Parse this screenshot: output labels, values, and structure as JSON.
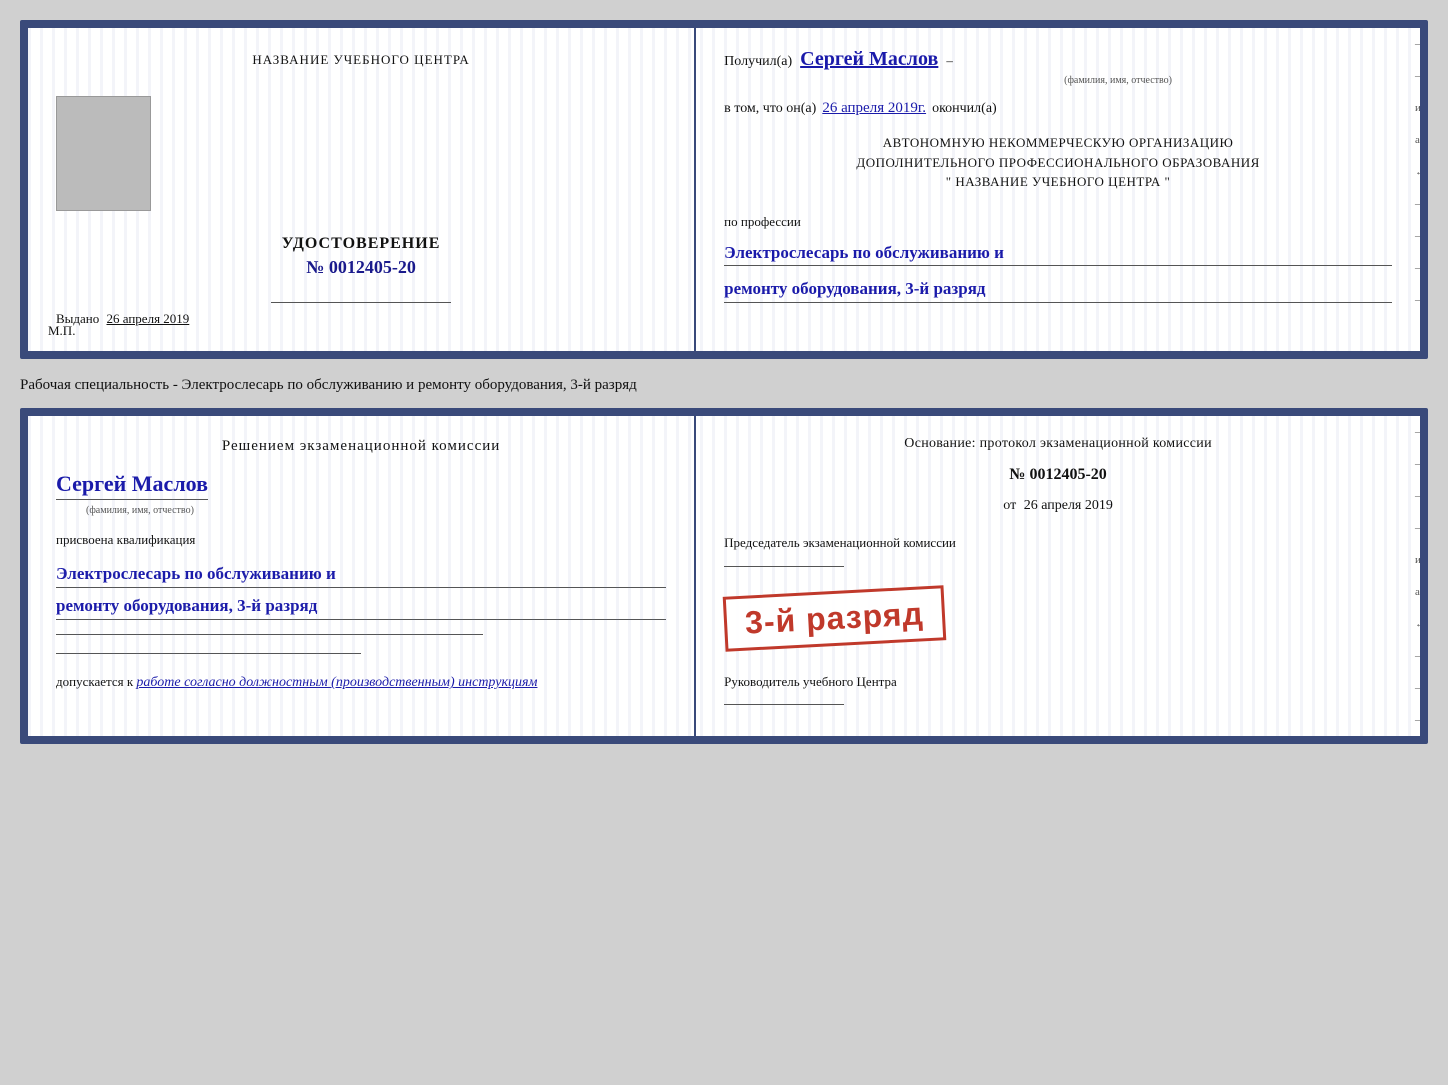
{
  "doc1": {
    "left": {
      "org_title": "НАЗВАНИЕ УЧЕБНОГО ЦЕНТРА",
      "cert_label": "УДОСТОВЕРЕНИЕ",
      "cert_number": "№ 0012405-20",
      "issue_label": "Выдано",
      "issue_date": "26 апреля 2019",
      "mp_label": "М.П."
    },
    "right": {
      "received_prefix": "Получил(а)",
      "recipient_name": "Сергей Маслов",
      "fio_sub": "(фамилия, имя, отчество)",
      "date_prefix": "в том, что он(а)",
      "date_value": "26 апреля 2019г.",
      "date_suffix": "окончил(а)",
      "org_line1": "АВТОНОМНУЮ НЕКОММЕРЧЕСКУЮ ОРГАНИЗАЦИЮ",
      "org_line2": "ДОПОЛНИТЕЛЬНОГО ПРОФЕССИОНАЛЬНОГО ОБРАЗОВАНИЯ",
      "org_line3": "\" НАЗВАНИЕ УЧЕБНОГО ЦЕНТРА \"",
      "profession_label": "по профессии",
      "profession_line1": "Электрослесарь по обслуживанию и",
      "profession_line2": "ремонту оборудования, 3-й разряд"
    }
  },
  "between_label": "Рабочая специальность - Электрослесарь по обслуживанию и ремонту оборудования, 3-й разряд",
  "doc2": {
    "left": {
      "komissia_title": "Решением экзаменационной комиссии",
      "name": "Сергей Маслов",
      "fio_sub": "(фамилия, имя, отчество)",
      "prisvoena": "присвоена квалификация",
      "qualification_line1": "Электрослесарь по обслуживанию и",
      "qualification_line2": "ремонту оборудования, 3-й разряд",
      "dopuskaetsya_prefix": "допускается к",
      "dopuskaetsya_text": "работе согласно должностным (производственным) инструкциям"
    },
    "right": {
      "osnova_text": "Основание: протокол экзаменационной комиссии",
      "proto_number": "№ 0012405-20",
      "proto_date_prefix": "от",
      "proto_date": "26 апреля 2019",
      "predsedatel_label": "Председатель экзаменационной комиссии",
      "stamp_text": "3-й разряд",
      "rukovoditel_label": "Руководитель учебного Центра"
    }
  }
}
